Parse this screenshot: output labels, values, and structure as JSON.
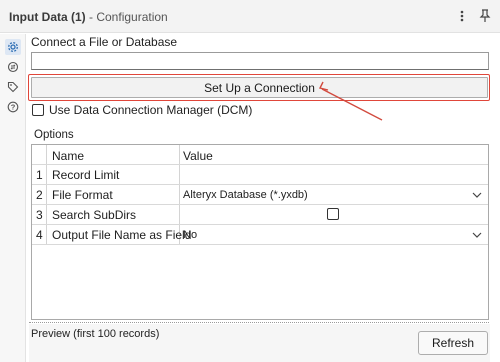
{
  "window": {
    "tool_name": "Input Data (1)",
    "section": "- Configuration",
    "menu_icon": "kebab-menu-icon",
    "pin_icon": "pin-icon"
  },
  "sidebar": {
    "items": [
      {
        "icon": "gear-icon"
      },
      {
        "icon": "connection-icon"
      },
      {
        "icon": "tag-icon"
      },
      {
        "icon": "help-icon"
      }
    ]
  },
  "connect": {
    "label": "Connect a File or Database",
    "value": "",
    "setup_button": "Set Up a Connection"
  },
  "dcm": {
    "label": "Use Data Connection Manager (DCM)",
    "checked": false
  },
  "options": {
    "title": "Options",
    "columns": [
      "Name",
      "Value"
    ],
    "rows": [
      {
        "num": "1",
        "name": "Record Limit",
        "value": ""
      },
      {
        "num": "2",
        "name": "File Format",
        "value": "Alteryx Database (*.yxdb)"
      },
      {
        "num": "3",
        "name": "Search SubDirs",
        "value": ""
      },
      {
        "num": "4",
        "name": "Output File Name as Field",
        "value": "No"
      }
    ]
  },
  "preview": {
    "label": "Preview (first 100 records)",
    "refresh_button": "Refresh"
  },
  "annotation": {
    "highlight_color": "#e0463a"
  }
}
